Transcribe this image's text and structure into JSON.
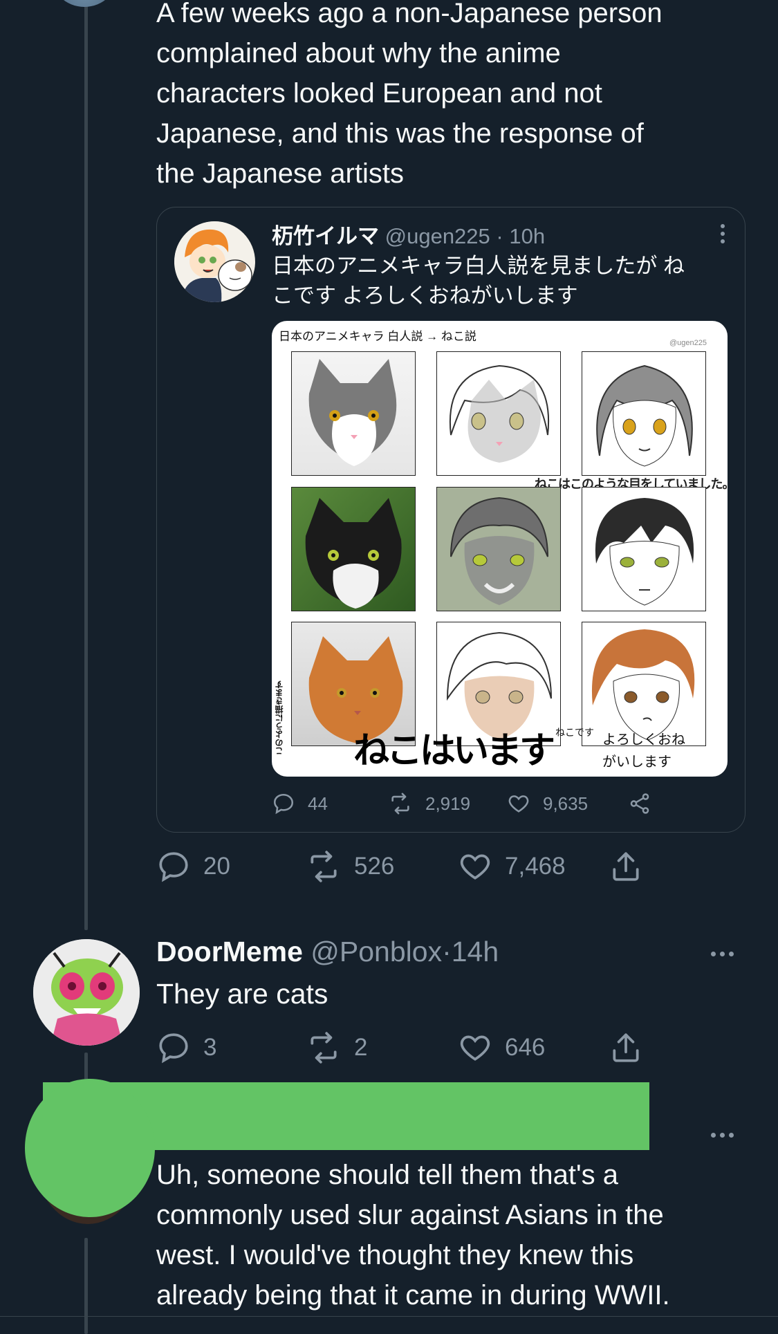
{
  "main_tweet": {
    "text_lines": [
      "A few weeks ago a non-Japanese person",
      "complained about why the anime",
      "characters looked European and not",
      "Japanese, and this was the response of",
      "the Japanese artists"
    ],
    "quote": {
      "name": "杤竹イルマ",
      "handle": "@ugen225",
      "dot": "·",
      "time": "10h",
      "text_lines": [
        "日本のアニメキャラ白人説を見ましたが ね",
        "こです よろしくおねがいします"
      ],
      "image": {
        "header": "日本のアニメキャラ 白人説 → ねこ説",
        "watermark": "@ugen225",
        "overlay_middle": "ねこはこのような目をしていました。",
        "side_text": "このように描きます",
        "big_text": "ねこはいます",
        "small_prefix": "ねこです",
        "small_text_1": "よろしくおね",
        "small_text_2": "がいします"
      },
      "stats": {
        "replies": "44",
        "retweets": "2,919",
        "likes": "9,635"
      }
    },
    "stats": {
      "replies": "20",
      "retweets": "526",
      "likes": "7,468"
    }
  },
  "reply_1": {
    "name": "DoorMeme",
    "handle": "@Ponblox",
    "dot": "·",
    "time": "14h",
    "text": "They are cats",
    "stats": {
      "replies": "3",
      "retweets": "2",
      "likes": "646"
    }
  },
  "reply_2": {
    "text_lines": [
      "Uh, someone should tell them that's a",
      "commonly used slur against Asians in the",
      "west. I would've thought they knew this",
      "already being that it came in during WWII."
    ],
    "redaction_color": "#63c465"
  },
  "colors": {
    "background": "#15202b",
    "text": "#f7f9f9",
    "muted": "#8b98a5",
    "border": "#38444d"
  }
}
